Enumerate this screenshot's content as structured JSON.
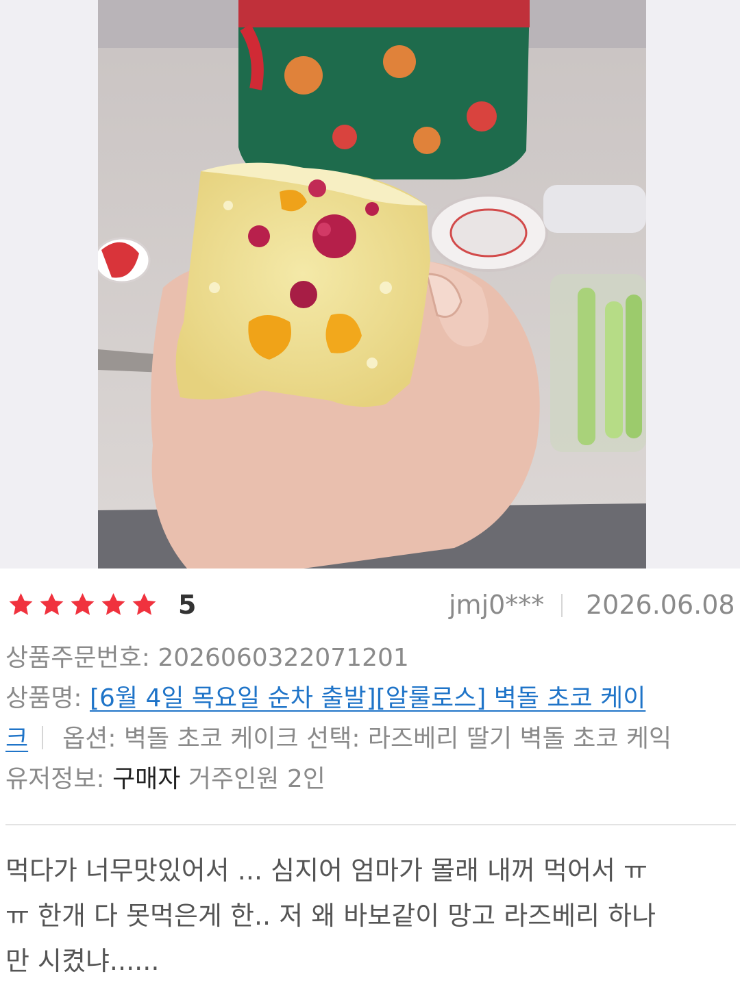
{
  "review": {
    "rating": "5",
    "stars_filled": 5,
    "stars_total": 5,
    "user_id": "jmj0***",
    "date": "2026.06.08",
    "order_label": "상품주문번호:",
    "order_number": "2026060322071201",
    "product_label": "상품명:",
    "product_name_line1": "[6월 4일 목요일 순차 출발][알룰로스] 벽돌 초코 케이",
    "product_name_line2": "크",
    "option_text": "옵션: 벽돌 초코 케이크 선택: 라즈베리 딸기 벽돌 초코 케익",
    "user_info_label": "유저정보:",
    "user_info_role": "구매자",
    "user_info_detail": "거주인원 2인",
    "body_lines": [
      "먹다가 너무맛있어서 ... 심지어 엄마가 몰래 내꺼 먹어서 ㅠ",
      "ㅠ 한개 다 못먹은게 한.. 저 왜 바보같이 망고 라즈베리 하나",
      "만 시켰냐......"
    ]
  },
  "colors": {
    "star": "#f0323e",
    "link": "#1f74c8",
    "muted_text": "#8a8a8a",
    "body_text": "#555555"
  }
}
